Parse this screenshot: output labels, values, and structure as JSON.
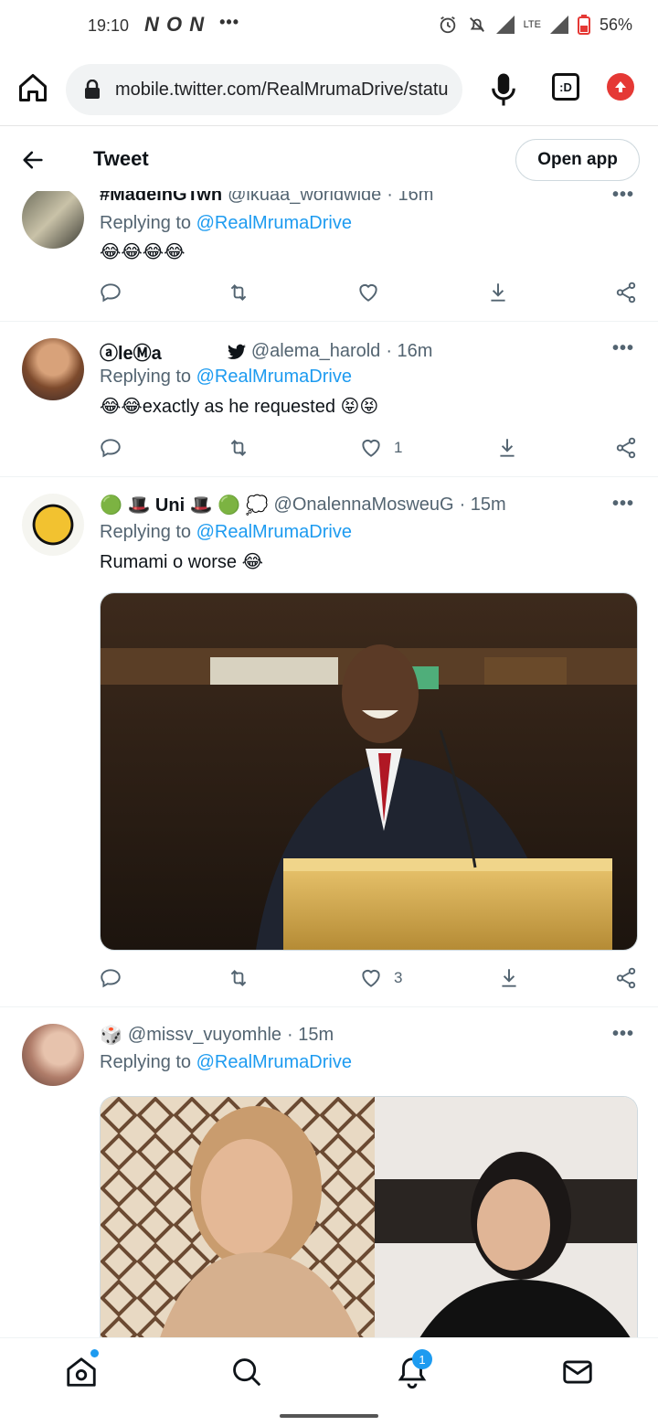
{
  "status_bar": {
    "time": "19:10",
    "app_icons": "N O N",
    "more": "•••",
    "network": "LTE",
    "battery": "56%"
  },
  "browser": {
    "url": "mobile.twitter.com/RealMrumaDrive/statu",
    "tab_label": ":D"
  },
  "header": {
    "title": "Tweet",
    "open_app": "Open app"
  },
  "tweets": [
    {
      "name": "#MadeInGTwn",
      "handle": "@ikuaa_worldwide",
      "time": "· 16m",
      "replying_prefix": "Replying to",
      "replying_to": "@RealMrumaDrive",
      "text": "😂😂😂😂",
      "likes": ""
    },
    {
      "name": "ⓐleⓂa",
      "handle": "@alema_harold",
      "time": "· 16m",
      "replying_prefix": "Replying to",
      "replying_to": "@RealMrumaDrive",
      "text": "😂😂exactly as he requested 😝😝",
      "likes": "1"
    },
    {
      "name": "🟢 🎩 Uni 🎩 🟢 💭",
      "handle": "@OnalennaMosweuG",
      "time": "· 15m",
      "replying_prefix": "Replying to",
      "replying_to": "@RealMrumaDrive",
      "text": "Rumami o worse 😂",
      "likes": "3"
    },
    {
      "name": "🎲",
      "handle": "@missv_vuyomhle",
      "time": "· 15m",
      "replying_prefix": "Replying to",
      "replying_to": "@RealMrumaDrive",
      "text": "",
      "likes": ""
    }
  ],
  "bottom_nav": {
    "notifications_badge": "1"
  },
  "colors": {
    "link": "#1d9bf0",
    "muted": "#536471",
    "text": "#0f1419"
  }
}
